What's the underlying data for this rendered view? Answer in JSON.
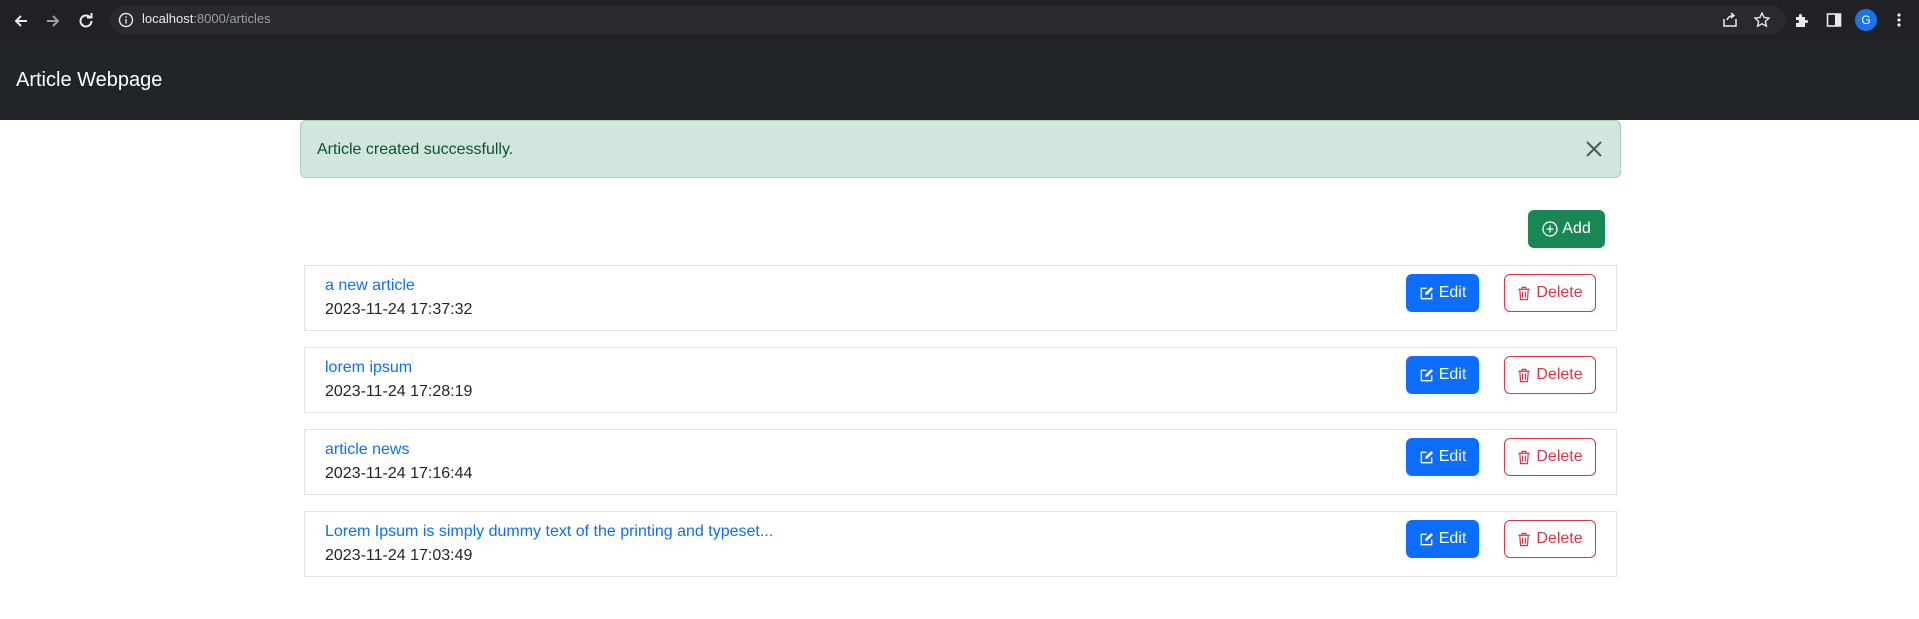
{
  "browser": {
    "url_host": "localhost",
    "url_rest": ":8000/articles",
    "profile_initial": "G"
  },
  "navbar": {
    "brand": "Article Webpage"
  },
  "alert": {
    "message": "Article created successfully."
  },
  "actions": {
    "add_label": "Add"
  },
  "articles": [
    {
      "title": "a new article",
      "date": "2023-11-24 17:37:32",
      "edit_label": "Edit",
      "delete_label": "Delete"
    },
    {
      "title": "lorem ipsum",
      "date": "2023-11-24 17:28:19",
      "edit_label": "Edit",
      "delete_label": "Delete"
    },
    {
      "title": "article news",
      "date": "2023-11-24 17:16:44",
      "edit_label": "Edit",
      "delete_label": "Delete"
    },
    {
      "title": "Lorem Ipsum is simply dummy text of the printing and typeset...",
      "date": "2023-11-24 17:03:49",
      "edit_label": "Edit",
      "delete_label": "Delete"
    }
  ],
  "colors": {
    "navbar": "#212529",
    "alert_bg": "#d1e7dd",
    "success": "#198754",
    "primary": "#0d6efd",
    "danger": "#dc3545"
  },
  "icons": {
    "back": "arrow-left-icon",
    "forward": "arrow-right-icon",
    "reload": "reload-icon",
    "add": "plus-circle-icon",
    "edit": "pencil-square-icon",
    "delete": "trash-icon",
    "close": "close-icon"
  }
}
